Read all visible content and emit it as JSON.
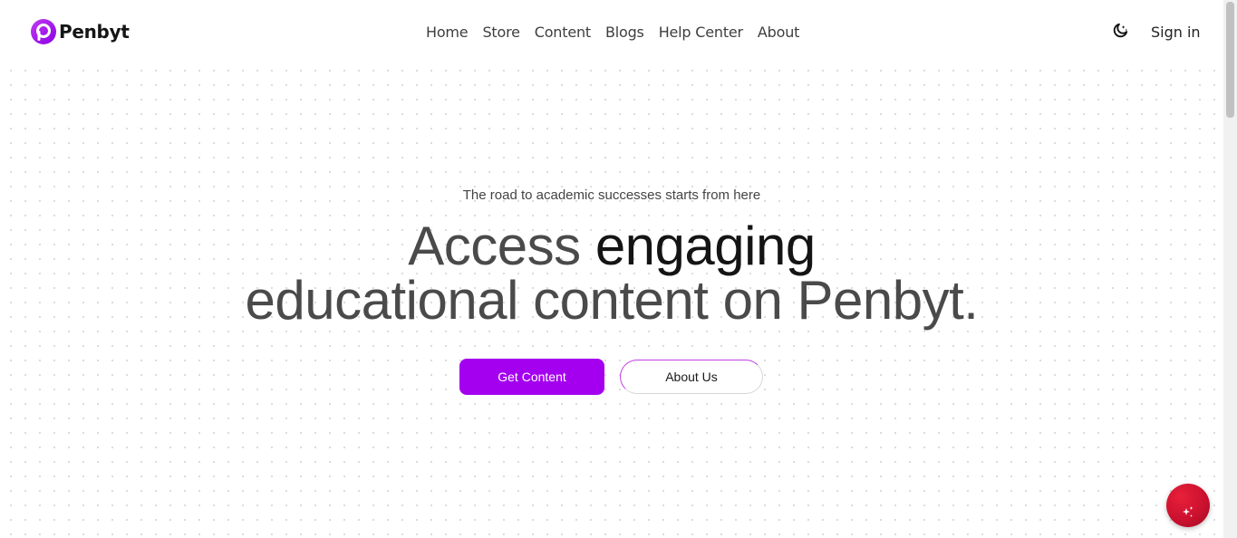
{
  "brand": {
    "name": "Penbyt",
    "color": "#a400ef"
  },
  "nav": {
    "items": [
      {
        "label": "Home"
      },
      {
        "label": "Store"
      },
      {
        "label": "Content"
      },
      {
        "label": "Blogs"
      },
      {
        "label": "Help Center"
      },
      {
        "label": "About"
      }
    ]
  },
  "header": {
    "theme_toggle_icon": "moon-icon",
    "signin_label": "Sign in"
  },
  "hero": {
    "tagline": "The road to academic successes starts from here",
    "headline_part1": "Access ",
    "headline_accent": "engaging",
    "headline_part2": "educational content on Penbyt.",
    "primary_button": "Get Content",
    "secondary_button": "About Us"
  },
  "fab": {
    "icon": "sparkles-icon",
    "color": "#c8102e"
  }
}
